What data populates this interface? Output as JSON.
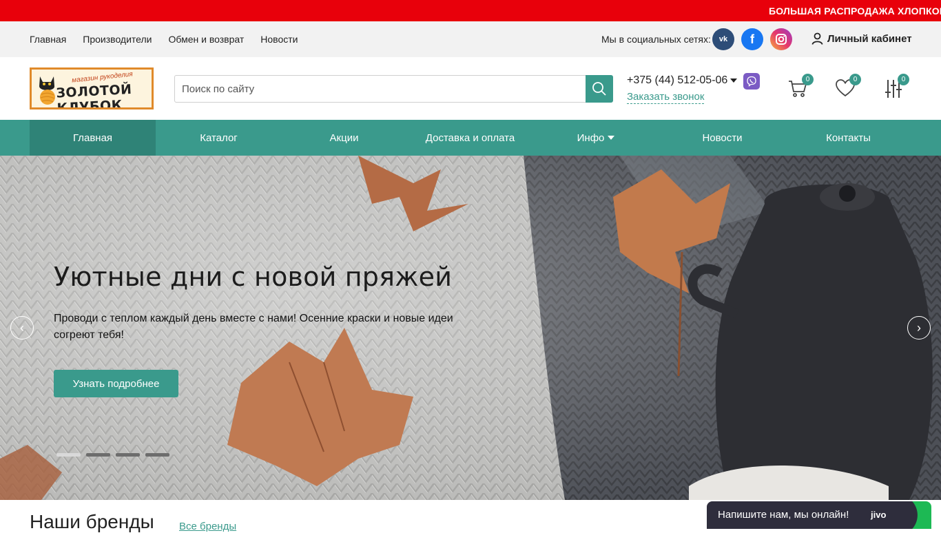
{
  "promo": {
    "text": "БОЛЬШАЯ РАСПРОДАЖА ХЛОПКОВ!"
  },
  "topbar": {
    "links": [
      "Главная",
      "Производители",
      "Обмен и возврат",
      "Новости"
    ],
    "social_label": "Мы в социальных сетях:",
    "social_icons": [
      "vk-icon",
      "facebook-icon",
      "instagram-icon"
    ],
    "cabinet": "Личный кабинет"
  },
  "header": {
    "logo_small": "магазин рукоделия",
    "logo_big": "ЗОЛОТОЙ КЛУБОК",
    "search_placeholder": "Поиск по сайту",
    "phone": "+375 (44) 512-05-06",
    "callback": "Заказать звонок",
    "cart_count": "0",
    "favorites_count": "0",
    "compare_count": "0"
  },
  "nav": {
    "items": [
      "Главная",
      "Каталог",
      "Акции",
      "Доставка и оплата",
      "Инфо",
      "Новости",
      "Контакты"
    ]
  },
  "hero": {
    "title": "Уютные дни с новой пряжей",
    "text": "Проводи с теплом каждый день вместе с нами! Осенние краски и новые идеи согреют тебя!",
    "button": "Узнать подробнее",
    "slides": 4,
    "active_slide": 1
  },
  "brands": {
    "title": "Наши бренды",
    "all_link": "Все бренды"
  },
  "chat": {
    "text": "Напишите нам, мы онлайн!",
    "logo": "jivo"
  },
  "colors": {
    "accent": "#3a9a8c",
    "promo": "#e8000b",
    "nav_active": "#2f8377"
  }
}
